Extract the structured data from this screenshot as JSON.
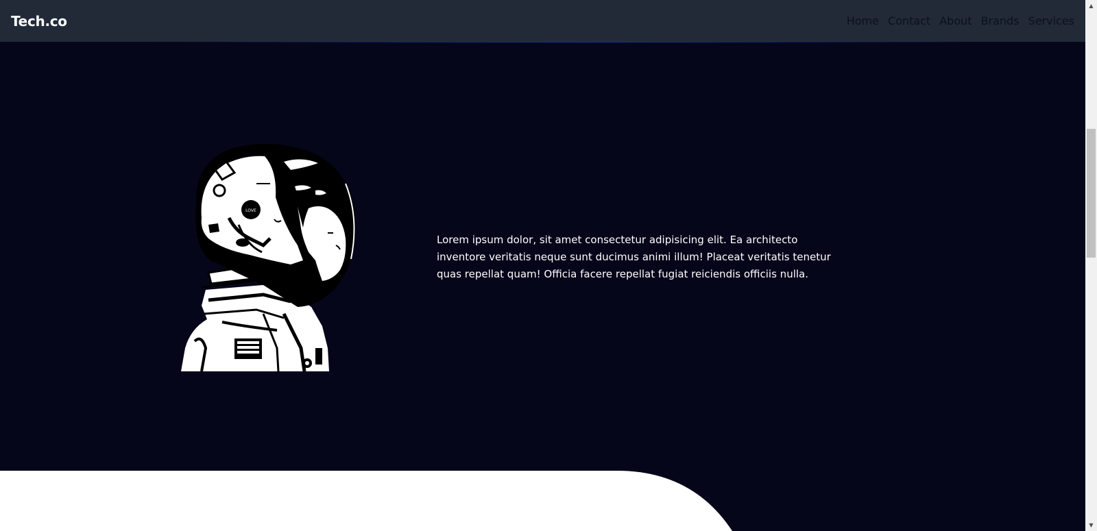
{
  "header": {
    "brand": "Tech.co",
    "nav": [
      {
        "label": "Home"
      },
      {
        "label": "Contact"
      },
      {
        "label": "About"
      },
      {
        "label": "Brands"
      },
      {
        "label": "Services"
      }
    ]
  },
  "hero": {
    "image_alt": "astronaut illustration",
    "text": "Lorem ipsum dolor, sit amet consectetur adipisicing elit. Ea architecto inventore veritatis neque sunt ducimus animi illum! Placeat veritatis tenetur quas repellat quam! Officia facere repellat fugiat reiciendis officiis nulla."
  },
  "colors": {
    "navbar_bg": "#222a38",
    "hero_bg": "#05061a",
    "text": "#ffffff",
    "nav_link": "#0d1017"
  },
  "scrollbar": {
    "up_icon": "scroll-up-arrow-icon",
    "down_icon": "scroll-down-arrow-icon"
  }
}
